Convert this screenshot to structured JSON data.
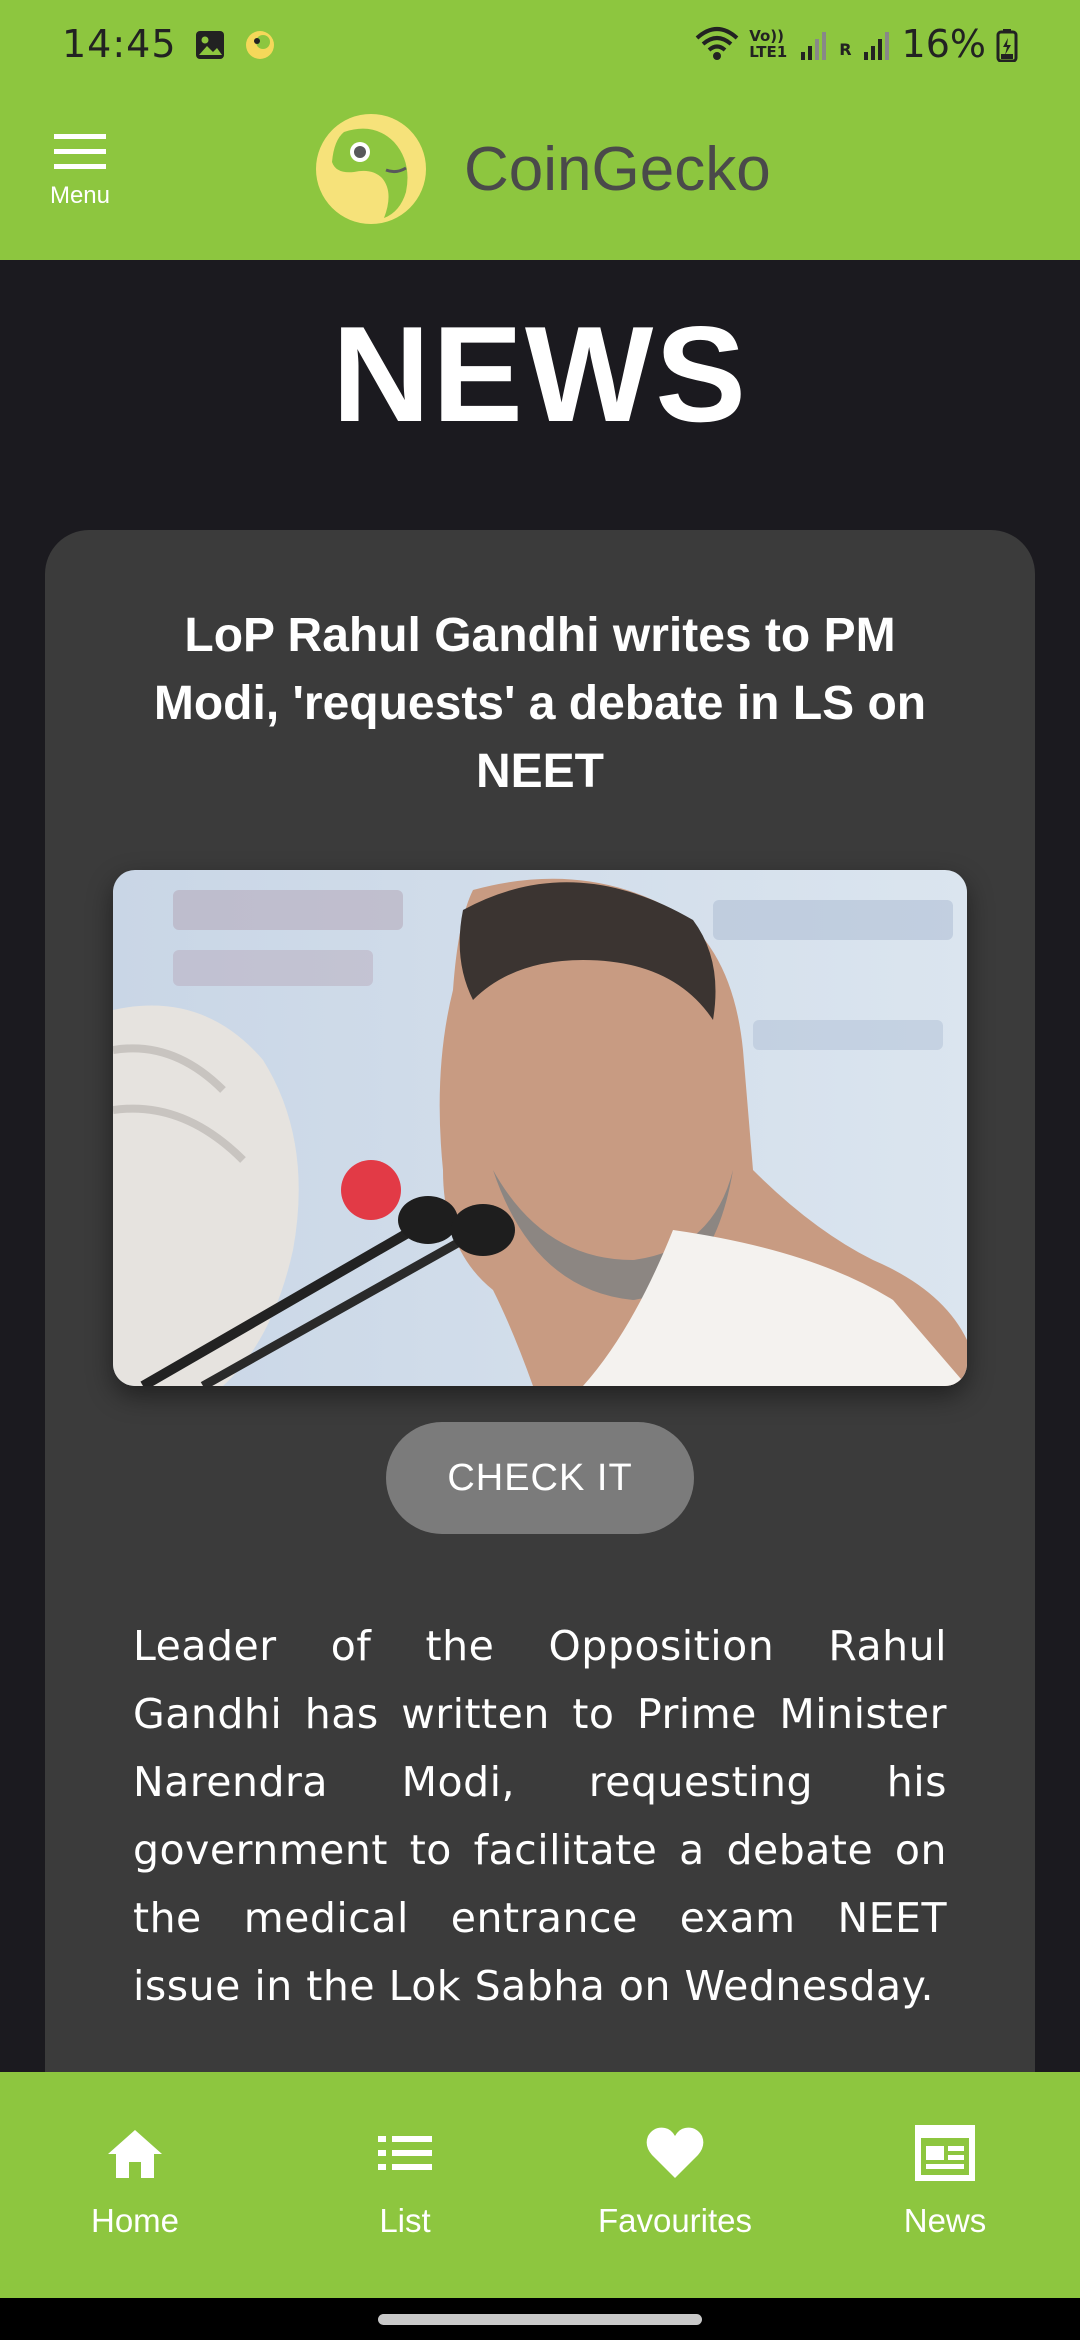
{
  "status_bar": {
    "time": "14:45",
    "battery": "16%",
    "network_labels": "Vo)) LTE1",
    "roaming_label": "R"
  },
  "header": {
    "menu_label": "Menu",
    "brand_name": "CoinGecko"
  },
  "page": {
    "title": "NEWS"
  },
  "article": {
    "title": "LoP Rahul Gandhi writes to PM Modi, 'requests' a debate in LS on NEET",
    "button_label": "CHECK IT",
    "body": "Leader of the Opposition Rahul Gandhi has written to Prime Minister Narendra Modi, requesting his government to facilitate a debate on the medical entrance exam NEET issue in the Lok Sabha on Wednesday."
  },
  "bottom_nav": {
    "items": [
      {
        "label": "Home",
        "icon": "home-icon"
      },
      {
        "label": "List",
        "icon": "list-icon"
      },
      {
        "label": "Favourites",
        "icon": "heart-icon"
      },
      {
        "label": "News",
        "icon": "newspaper-icon"
      }
    ]
  },
  "colors": {
    "brand_green": "#8dc63f",
    "background": "#1b1a1f",
    "card": "#3b3b3b",
    "button": "#7b7b7b"
  }
}
